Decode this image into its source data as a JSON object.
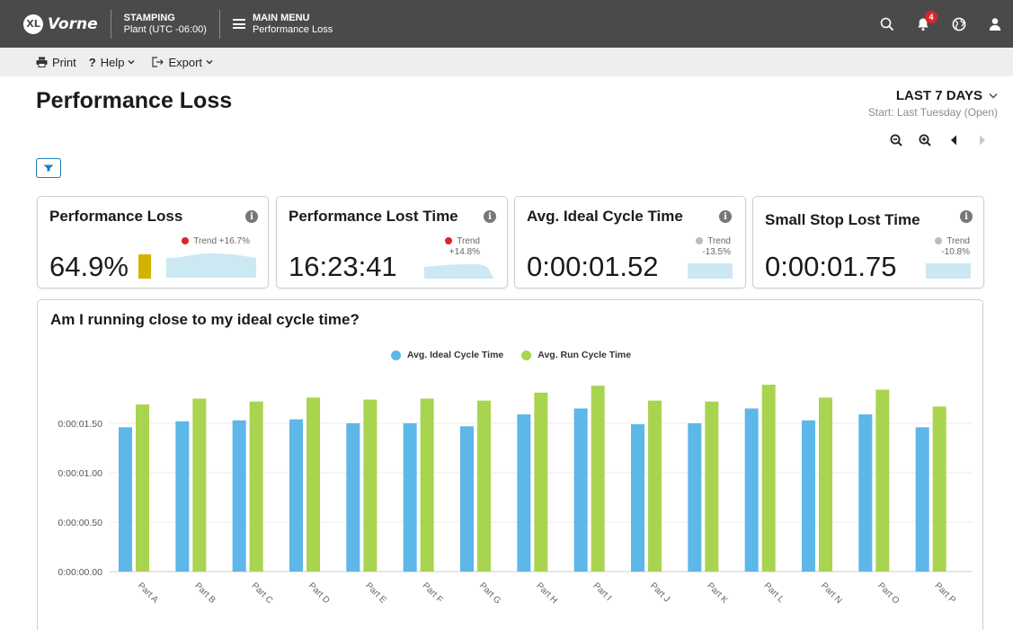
{
  "topbar": {
    "logo_badge": "XL",
    "logo_text": "Vorne",
    "location": {
      "title": "STAMPING",
      "subtitle": "Plant (UTC -06:00)"
    },
    "menu": {
      "title": "MAIN MENU",
      "subtitle": "Performance Loss"
    },
    "notification_count": "4",
    "icons": [
      "search-icon",
      "bell-icon",
      "globe-icon",
      "user-icon"
    ]
  },
  "toolbar": {
    "print_label": "Print",
    "help_label": "Help",
    "export_label": "Export"
  },
  "header": {
    "title": "Performance Loss",
    "range_label": "LAST 7 DAYS",
    "range_sub": "Start: Last Tuesday (Open)"
  },
  "cards": [
    {
      "title": "Performance Loss",
      "value": "64.9%",
      "trend_label": "Trend +16.7%",
      "trend_color": "#d9262c"
    },
    {
      "title": "Performance Lost Time",
      "value": "16:23:41",
      "trend_label": "Trend",
      "trend_change": "+14.8%",
      "trend_color": "#d9262c"
    },
    {
      "title": "Avg. Ideal Cycle Time",
      "value": "0:00:01.52",
      "trend_label": "Trend",
      "trend_change": "-13.5%",
      "trend_color": "#bbbbbb"
    },
    {
      "title": "Small Stop Lost Time",
      "value": "0:00:01.75",
      "trend_label": "Trend",
      "trend_change": "-10.8%",
      "trend_color": "#bbbbbb"
    }
  ],
  "colors": {
    "topbar": "#4a4a4a",
    "ideal": "#5db7e8",
    "run": "#a9d44f",
    "sparkline": "#cce8f2",
    "accent": "#1f7bbd",
    "indicator": "#d4b200"
  },
  "chart_data": {
    "type": "bar",
    "title": "Am I running close to my ideal cycle time?",
    "categories": [
      "Part A",
      "Part B",
      "Part C",
      "Part D",
      "Part E",
      "Part F",
      "Part G",
      "Part H",
      "Part I",
      "Part J",
      "Part K",
      "Part L",
      "Part N",
      "Part O",
      "Part P"
    ],
    "series": [
      {
        "name": "Avg. Ideal Cycle Time",
        "color": "#5db7e8",
        "values": [
          1.46,
          1.52,
          1.53,
          1.54,
          1.5,
          1.5,
          1.47,
          1.59,
          1.65,
          1.49,
          1.5,
          1.65,
          1.53,
          1.59,
          1.46
        ]
      },
      {
        "name": "Avg. Run Cycle Time",
        "color": "#a9d44f",
        "values": [
          1.69,
          1.75,
          1.72,
          1.76,
          1.74,
          1.75,
          1.73,
          1.81,
          1.88,
          1.73,
          1.72,
          1.89,
          1.76,
          1.84,
          1.67
        ]
      }
    ],
    "yticks": [
      "0:00:00.00",
      "0:00:00.50",
      "0:00:01.00",
      "0:00:01.50"
    ],
    "ytick_values": [
      0,
      0.5,
      1.0,
      1.5
    ],
    "ylim": [
      0,
      2.0
    ],
    "grid": true,
    "legend": "top-center"
  }
}
